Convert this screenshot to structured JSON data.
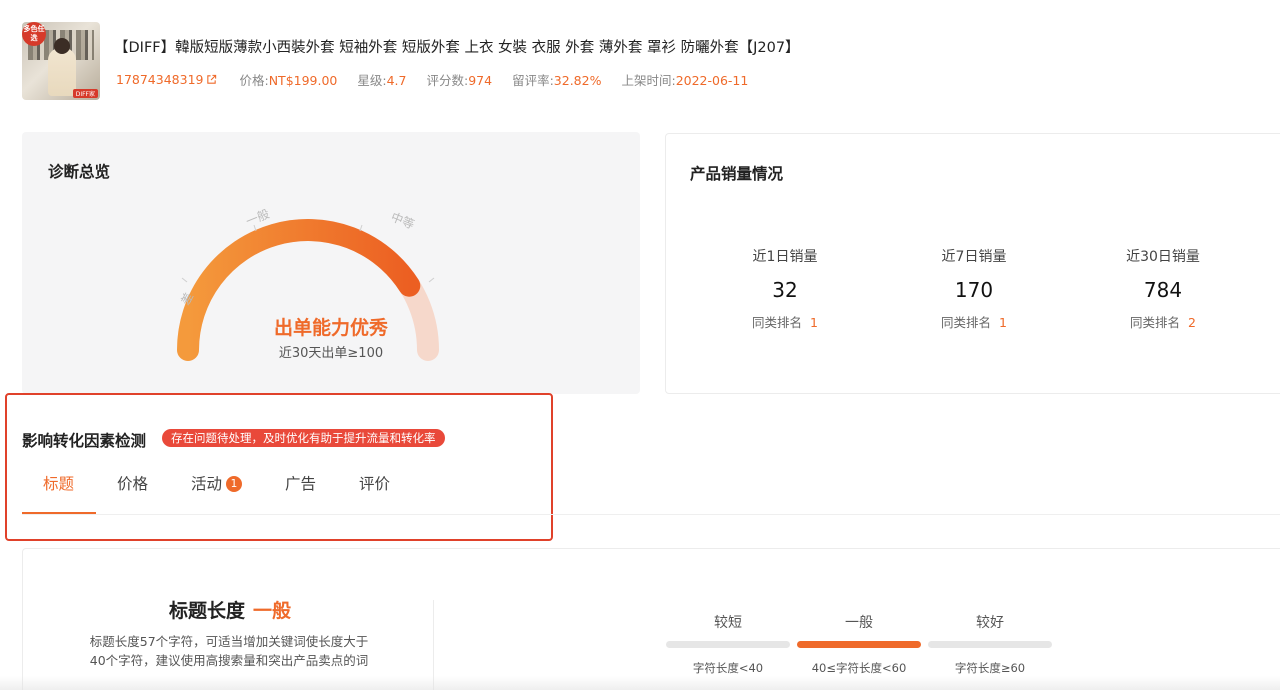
{
  "product": {
    "thumb_badge": "多色任选",
    "thumb_tag": "DIFF家",
    "title": "【DIFF】韓版短版薄款小西裝外套 短袖外套 短版外套 上衣 女裝 衣服 外套 薄外套 罩衫 防曬外套【J207】",
    "id": "17874348319",
    "price_label": "价格:",
    "price": "NT$199.00",
    "rating_label": "星级:",
    "rating": "4.7",
    "reviews_label": "评分数:",
    "reviews": "974",
    "retention_label": "留评率:",
    "retention": "32.82%",
    "listed_label": "上架时间:",
    "listed": "2022-06-11"
  },
  "diagnosis": {
    "title": "诊断总览",
    "gauge_labels": [
      "差",
      "一般",
      "中等",
      "优秀"
    ],
    "gauge_level": 0.82,
    "main_text": "出单能力优秀",
    "sub_text": "近30天出单≥100"
  },
  "sales": {
    "title": "产品销量情况",
    "rank_label": "同类排名",
    "columns": [
      {
        "label": "近1日销量",
        "value": "32",
        "rank": "1"
      },
      {
        "label": "近7日销量",
        "value": "170",
        "rank": "1"
      },
      {
        "label": "近30日销量",
        "value": "784",
        "rank": "2"
      }
    ]
  },
  "factors": {
    "title": "影响转化因素检测",
    "badge": "存在问题待处理，及时优化有助于提升流量和转化率",
    "tabs": [
      {
        "label": "标题"
      },
      {
        "label": "价格"
      },
      {
        "label": "活动",
        "count": "1"
      },
      {
        "label": "广告"
      },
      {
        "label": "评价"
      }
    ]
  },
  "title_length": {
    "heading": "标题长度",
    "level": "一般",
    "desc": "标题长度57个字符，可适当增加关键词使长度大于40个字符，建议使用高搜索量和突出产品卖点的词",
    "scale": [
      {
        "name": "较短",
        "rule": "字符长度<40"
      },
      {
        "name": "一般",
        "rule": "40≤字符长度<60"
      },
      {
        "name": "较好",
        "rule": "字符长度≥60"
      }
    ]
  },
  "colors": {
    "accent": "#ef6a2a",
    "alert": "#e0412a",
    "badge": "#e9493a",
    "card_bg": "#f5f5f6"
  }
}
